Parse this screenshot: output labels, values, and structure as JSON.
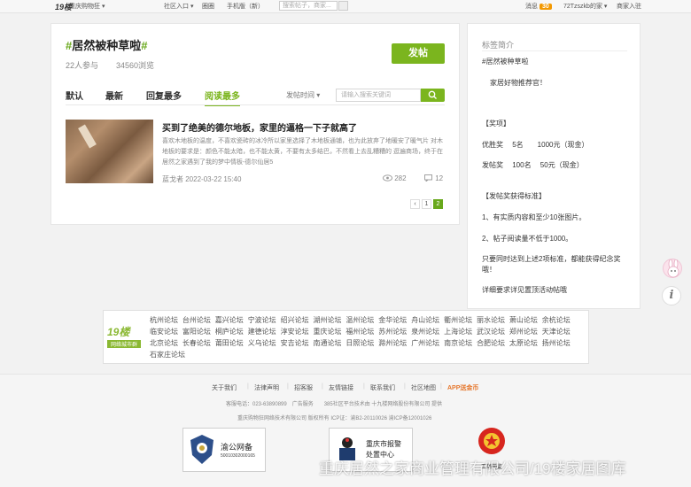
{
  "topbar": {
    "logo": "19楼",
    "site": "重庆购物狂",
    "nav": [
      "社区入口",
      "圈圈",
      "手机版（新）"
    ],
    "search_placeholder": "搜索帖子，商家...",
    "message_label": "消息",
    "message_count": "30",
    "user": "72Tzszkb的家",
    "merchant": "商家入驻"
  },
  "topic": {
    "hash_open": "#",
    "name": "居然被种草啦",
    "hash_close": "#",
    "participants": "22人参与",
    "views": "34560浏览",
    "post_button": "发帖"
  },
  "tabs": [
    "默认",
    "最新",
    "回复最多",
    "阅读最多"
  ],
  "active_tab": 3,
  "sort_label": "发帖时间",
  "keyword_placeholder": "请输入搜索关键词",
  "post": {
    "title": "买到了绝美的德尔地板，家里的逼格一下子就高了",
    "excerpt": "喜欢木地板的温度，不喜欢瓷砖的冰冷所以家里选择了木地板通铺，也为此放弃了地暖安了暖气片 对木地板的要求是：颜色不能太暗，也不能太黄，不要有太多结巴，不然看上去乱糟糟的 逛遍商场，终于在居然之家遇到了我的梦中情板-德尔仙居5",
    "author": "蓝戈者",
    "date": "2022-03-22 15:40",
    "views": "282",
    "replies": "12"
  },
  "pagination": [
    "‹",
    "1",
    "2"
  ],
  "sidebar": {
    "heading": "标签简介",
    "tag": "#居然被种草啦",
    "slogan": "家居好物推荐官！",
    "prize_heading": "【奖项】",
    "prize1": "优胜奖　 5名　　1000元（现金）",
    "prize2": "发帖奖　 100名　 50元（现金）",
    "rules_heading": "【发帖奖获得标准】",
    "rule1": "1、有实质内容和至少10张图片。",
    "rule2": " 2、帖子阅读量不低于1000。",
    "rule3a": "只要同时达到上述2项标准，都能获得纪念奖",
    "rule3b": "哦！",
    "rule4": "详细要求详见置顶活动帖哦"
  },
  "cities": {
    "logo_text": "19楼",
    "logo_sub": "网络城市群",
    "row1": [
      "杭州论坛",
      "台州论坛",
      "嘉兴论坛",
      "宁波论坛",
      "绍兴论坛",
      "湖州论坛",
      "温州论坛",
      "金华论坛",
      "舟山论坛",
      "衢州论坛",
      "丽水论坛",
      "萧山论坛",
      "余杭论坛"
    ],
    "row2": [
      "临安论坛",
      "富阳论坛",
      "桐庐论坛",
      "建德论坛",
      "淳安论坛",
      "重庆论坛",
      "福州论坛",
      "苏州论坛",
      "泉州论坛",
      "上海论坛",
      "武汉论坛",
      "郑州论坛",
      "天津论坛"
    ],
    "row3": [
      "北京论坛",
      "长春论坛",
      "莆田论坛",
      "义乌论坛",
      "安吉论坛",
      "南通论坛",
      "日照论坛",
      "滁州论坛",
      "广州论坛",
      "南京论坛",
      "合肥论坛",
      "太原论坛",
      "扬州论坛"
    ],
    "row4": [
      "石家庄论坛"
    ]
  },
  "footer": {
    "nav": [
      "关于我们",
      "法律声明",
      "招客服",
      "友情链接",
      "联系我们",
      "社区地图",
      "APP送金币"
    ],
    "line1": "客服电话：023-63890899　广告服务　　385社区平台技术由 十九楼网络股份有限公司 提供",
    "line2": "重庆购物狂网络技术有限公司  版权所有  ICP证：渝B2-20110026  渝ICP备12001026",
    "badge1_title": "渝公网备",
    "badge1_sub": "50010302000165",
    "badge2_line1": "重庆市报警",
    "badge2_line2": "处置中心",
    "badge3_text": "工商网监"
  },
  "watermark": "重庆居然之家商业管理有限公司/19楼家居图库",
  "colors": {
    "brand_green": "#7bb51e",
    "badge_orange": "#f39800",
    "app_orange": "#e6782e"
  }
}
